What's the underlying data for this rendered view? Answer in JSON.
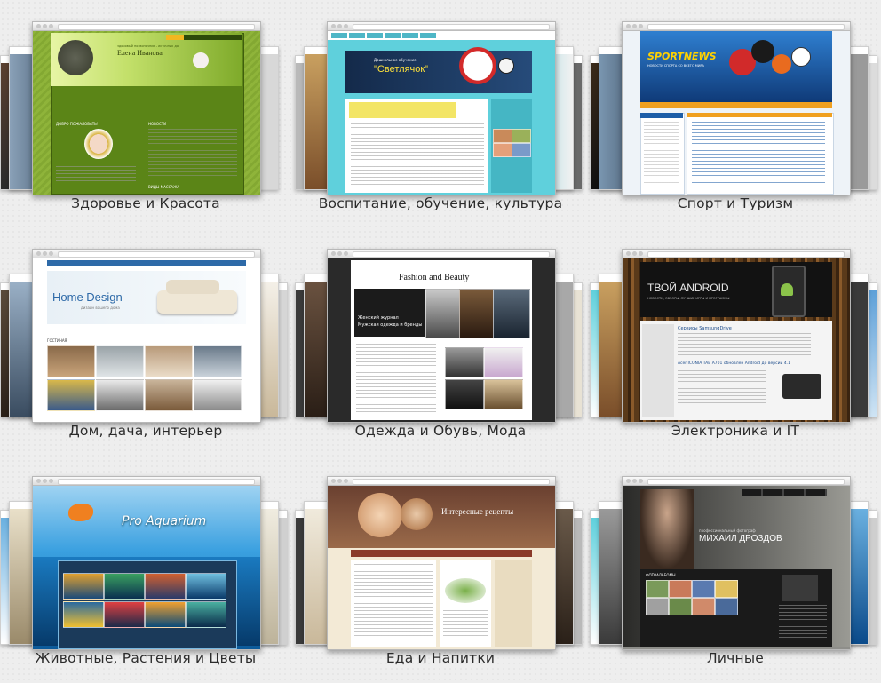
{
  "categories": [
    {
      "id": "health",
      "caption": "Здоровье и Красота",
      "site_title": "Елена Иванова",
      "site_sub": "здоровый позвоночник - источник долголетия",
      "welcome": "ДОБРО ПОЖАЛОВАТЬ!",
      "news": "НОВОСТИ",
      "footer": "ВИДЫ МАССАЖА",
      "accent": "#6a9a1a"
    },
    {
      "id": "edu",
      "caption": "Воспитание, обучение, культура",
      "site_title": "\"Светлячок\"",
      "site_sub": "Дошкольное обучение",
      "accent": "#4ec8d8"
    },
    {
      "id": "sport",
      "caption": "Спорт и Туризм",
      "site_title": "SPORTNEWS",
      "site_sub": "НОВОСТИ СПОРТА СО ВСЕГО МИРА",
      "accent": "#1d5ea8"
    },
    {
      "id": "home",
      "caption": "Дом, дача, интерьер",
      "site_title": "Home Design",
      "site_sub": "дизайн вашего дома",
      "section": "ГОСТИНАЯ",
      "accent": "#2e6aa8"
    },
    {
      "id": "fashion",
      "caption": "Одежда и Обувь, Мода",
      "site_title": "Fashion and Beauty",
      "banner_line1": "Женский журнал",
      "banner_line2": "Мужская одежда и бренды",
      "accent": "#222222"
    },
    {
      "id": "electronics",
      "caption": "Электроника и IT",
      "site_title": "ТВОЙ ANDROID",
      "site_sub": "НОВОСТИ, ОБЗОРЫ, ЛУЧШИЕ ИГРЫ И ПРОГРАММЫ",
      "headline": "Сервисы SamsungDrive",
      "headline2": "Acer ICONIA TAB A701 обновлен Android до версии 4.1",
      "accent": "#1a1a1a"
    },
    {
      "id": "animals",
      "caption": "Животные, Растения и Цветы",
      "site_title": "Pro Aquarium",
      "accent": "#1f86c9"
    },
    {
      "id": "food",
      "caption": "Еда и Напитки",
      "site_title": "Интересные рецепты",
      "accent": "#8a5a3c"
    },
    {
      "id": "personal",
      "caption": "Личные",
      "site_title": "МИХАИЛ ДРОЗДОВ",
      "site_sub": "профессиональный фотограф",
      "gallery": "ФОТОАЛЬБОМЫ",
      "accent": "#3a3a3a"
    }
  ]
}
